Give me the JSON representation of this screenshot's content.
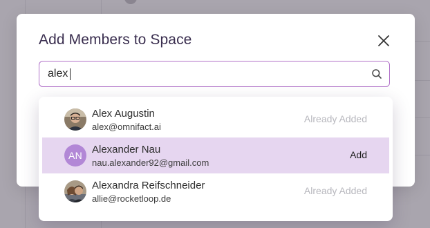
{
  "modal": {
    "title": "Add Members to Space"
  },
  "search": {
    "value": "alex",
    "placeholder": ""
  },
  "results": [
    {
      "name": "Alex Augustin",
      "email": "alex@omnifact.ai",
      "action": "Already Added",
      "avatar": "photo",
      "highlighted": false
    },
    {
      "name": "Alexander Nau",
      "email": "nau.alexander92@gmail.com",
      "action": "Add",
      "avatar": "AN",
      "highlighted": true
    },
    {
      "name": "Alexandra Reifschneider",
      "email": "allie@rocketloop.de",
      "action": "Already Added",
      "avatar": "photo",
      "highlighted": false
    }
  ],
  "colors": {
    "accent_border": "#b06fc8",
    "highlight_row": "#e6d6f0",
    "initials_avatar": "#b287d6",
    "title_text": "#3a2e4f",
    "muted_action": "#b7b7bd"
  },
  "icons": {
    "close": "close-icon",
    "search": "search-icon"
  }
}
